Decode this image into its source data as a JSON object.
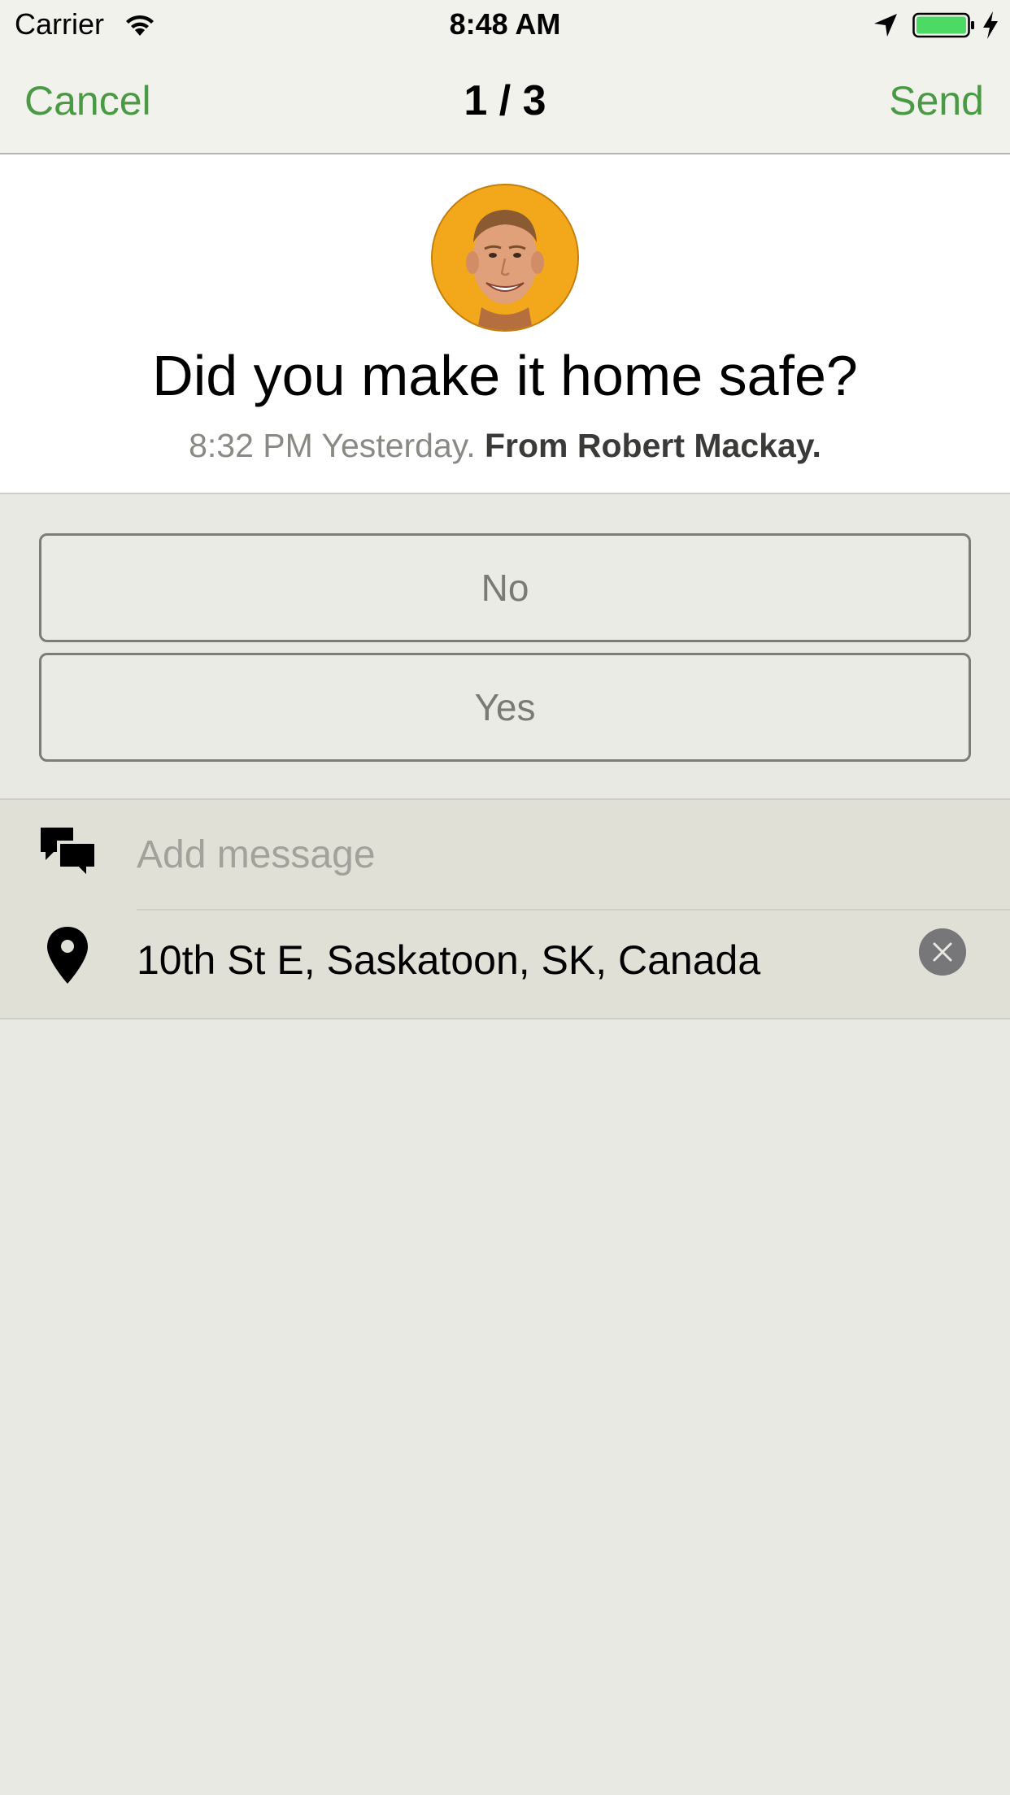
{
  "status_bar": {
    "carrier": "Carrier",
    "time": "8:48 AM",
    "battery_color": "#4cd964"
  },
  "nav": {
    "cancel_label": "Cancel",
    "title": "1 / 3",
    "send_label": "Send",
    "accent_color": "#4a9a45"
  },
  "message": {
    "question": "Did you make it home safe?",
    "time": "8:32 PM Yesterday.",
    "from": "From Robert Mackay."
  },
  "choices": [
    {
      "label": "No"
    },
    {
      "label": "Yes"
    }
  ],
  "compose": {
    "message_placeholder": "Add message",
    "message_value": "",
    "location": "10th St E, Saskatoon, SK, Canada"
  },
  "icons": {
    "wifi": "wifi-icon",
    "location_arrow": "location-arrow-icon",
    "battery": "battery-icon",
    "charging": "charging-icon",
    "avatar": "avatar",
    "chat": "chat-bubbles-icon",
    "pin": "map-pin-icon",
    "clear": "clear-icon"
  }
}
